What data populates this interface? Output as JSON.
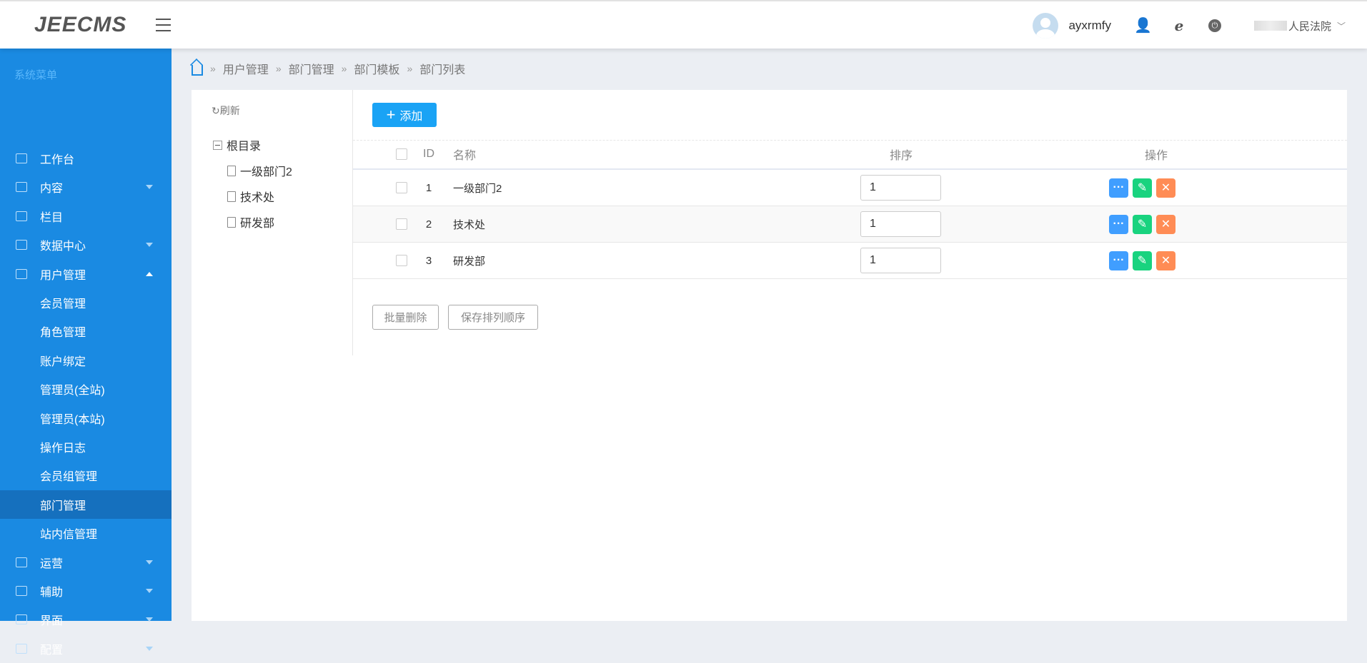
{
  "header": {
    "logo": "JEECMS",
    "username": "ayxrmfy",
    "org": "人民法院"
  },
  "sidebar": {
    "title": "系统菜单",
    "items": [
      {
        "label": "工作台",
        "arrow": ""
      },
      {
        "label": "内容",
        "arrow": "down"
      },
      {
        "label": "栏目",
        "arrow": ""
      },
      {
        "label": "数据中心",
        "arrow": "down"
      },
      {
        "label": "用户管理",
        "arrow": "up"
      },
      {
        "label": "会员管理",
        "sub": true
      },
      {
        "label": "角色管理",
        "sub": true
      },
      {
        "label": "账户绑定",
        "sub": true
      },
      {
        "label": "管理员(全站)",
        "sub": true
      },
      {
        "label": "管理员(本站)",
        "sub": true
      },
      {
        "label": "操作日志",
        "sub": true
      },
      {
        "label": "会员组管理",
        "sub": true
      },
      {
        "label": "部门管理",
        "sub": true,
        "active": true
      },
      {
        "label": "站内信管理",
        "sub": true
      },
      {
        "label": "运营",
        "arrow": "down"
      },
      {
        "label": "辅助",
        "arrow": "down"
      },
      {
        "label": "界面",
        "arrow": "down"
      },
      {
        "label": "配置",
        "arrow": "down"
      }
    ]
  },
  "breadcrumb": [
    "用户管理",
    "部门管理",
    "部门模板",
    "部门列表"
  ],
  "tree": {
    "refresh": "刷新",
    "root": "根目录",
    "children": [
      "一级部门2",
      "技术处",
      "研发部"
    ]
  },
  "toolbar": {
    "add": "添加"
  },
  "table": {
    "headers": {
      "id": "ID",
      "name": "名称",
      "sort": "排序",
      "ops": "操作"
    },
    "rows": [
      {
        "id": "1",
        "name": "一级部门2",
        "sort": "1"
      },
      {
        "id": "2",
        "name": "技术处",
        "sort": "1"
      },
      {
        "id": "3",
        "name": "研发部",
        "sort": "1"
      }
    ]
  },
  "footer": {
    "batch_delete": "批量删除",
    "save_order": "保存排列顺序"
  },
  "colors": {
    "sidebar": "#1a8ae2",
    "active": "#1570be",
    "view": "#409eff",
    "edit": "#19d37f",
    "delete": "#ff8c55"
  }
}
